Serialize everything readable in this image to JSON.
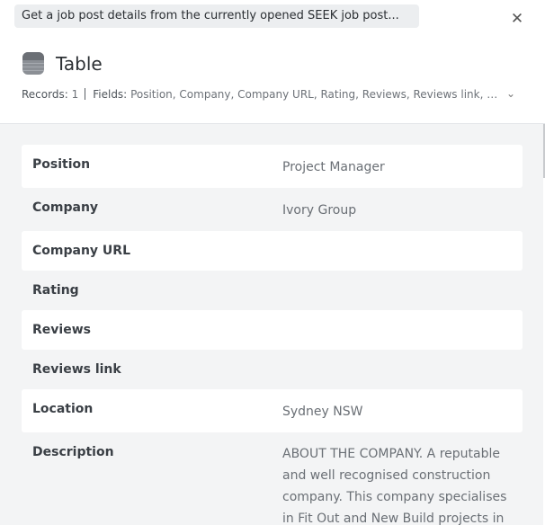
{
  "task": {
    "label": "Get a job post details from the currently opened SEEK job post..."
  },
  "header": {
    "title": "Table",
    "records_label": "Records:",
    "records_count": "1",
    "fields_label": "Fields:",
    "fields_value": "Position, Company, Company URL, Rating, Reviews, Reviews link, L..."
  },
  "icons": {
    "close": "close-icon",
    "table": "table-icon",
    "chevron": "chevron-down-icon"
  },
  "fields": [
    {
      "key": "Position",
      "value": "Project Manager"
    },
    {
      "key": "Company",
      "value": "Ivory Group"
    },
    {
      "key": "Company URL",
      "value": ""
    },
    {
      "key": "Rating",
      "value": ""
    },
    {
      "key": "Reviews",
      "value": ""
    },
    {
      "key": "Reviews link",
      "value": ""
    },
    {
      "key": "Location",
      "value": "Sydney NSW"
    },
    {
      "key": "Description",
      "value": "ABOUT THE COMPANY. A reputable and well recognised construction company. This company specialises in Fit Out and New Build projects in"
    }
  ]
}
